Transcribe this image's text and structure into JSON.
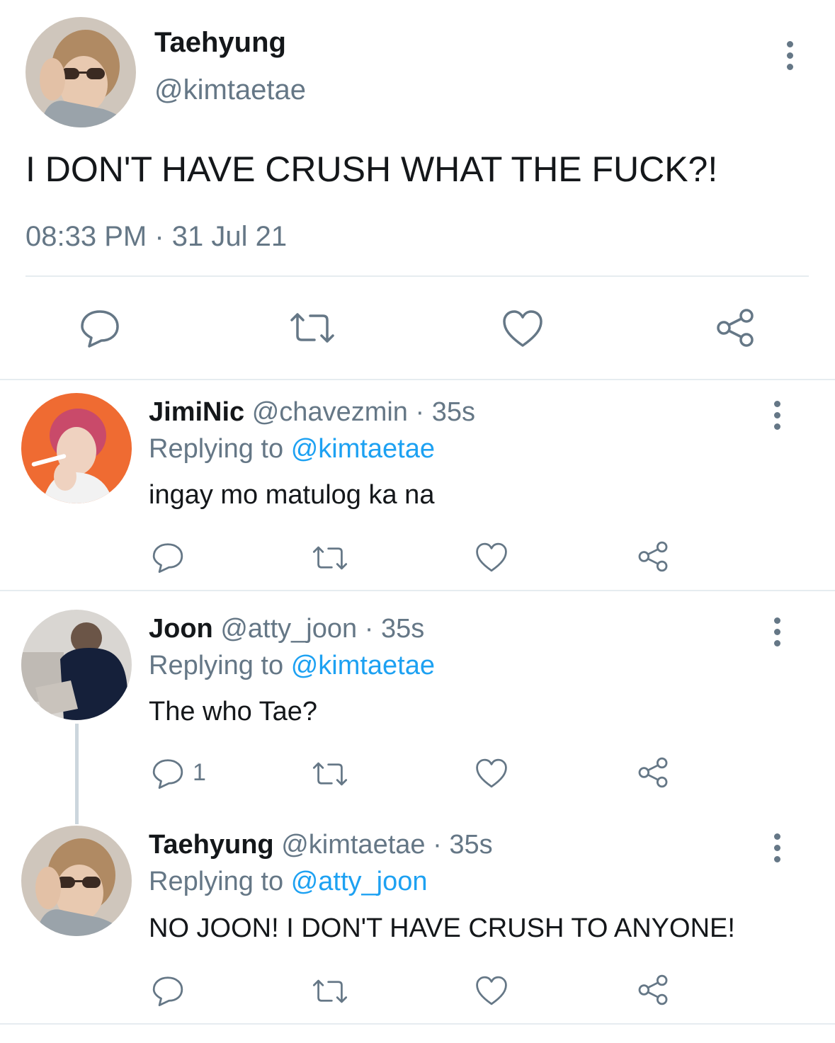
{
  "main_tweet": {
    "display_name": "Taehyung",
    "handle": "@kimtaetae",
    "text": "I DON'T HAVE CRUSH WHAT THE FUCK?!",
    "time": "08:33 PM",
    "separator": "·",
    "date": "31 Jul 21",
    "avatar_icon": "avatar-photo-icon",
    "actions": [
      "reply-icon",
      "retweet-icon",
      "like-icon",
      "share-icon"
    ]
  },
  "replies": [
    {
      "display_name": "JimiNic",
      "handle": "@chavezmin",
      "time_sep": "·",
      "time": "35s",
      "replying_label": "Replying to",
      "replying_to": "@kimtaetae",
      "text": "ingay mo matulog ka na",
      "reply_count": ""
    },
    {
      "display_name": "Joon",
      "handle": "@atty_joon",
      "time_sep": "·",
      "time": "35s",
      "replying_label": "Replying to",
      "replying_to": "@kimtaetae",
      "text": "The who Tae?",
      "reply_count": "1"
    },
    {
      "display_name": "Taehyung",
      "handle": "@kimtaetae",
      "time_sep": "·",
      "time": "35s",
      "replying_label": "Replying to",
      "replying_to": "@atty_joon",
      "text": "NO JOON! I DON'T HAVE CRUSH TO ANYONE!",
      "reply_count": ""
    }
  ],
  "colors": {
    "text": "#14171a",
    "secondary": "#657786",
    "link": "#1da1f2",
    "divider": "#e6ecf0"
  }
}
